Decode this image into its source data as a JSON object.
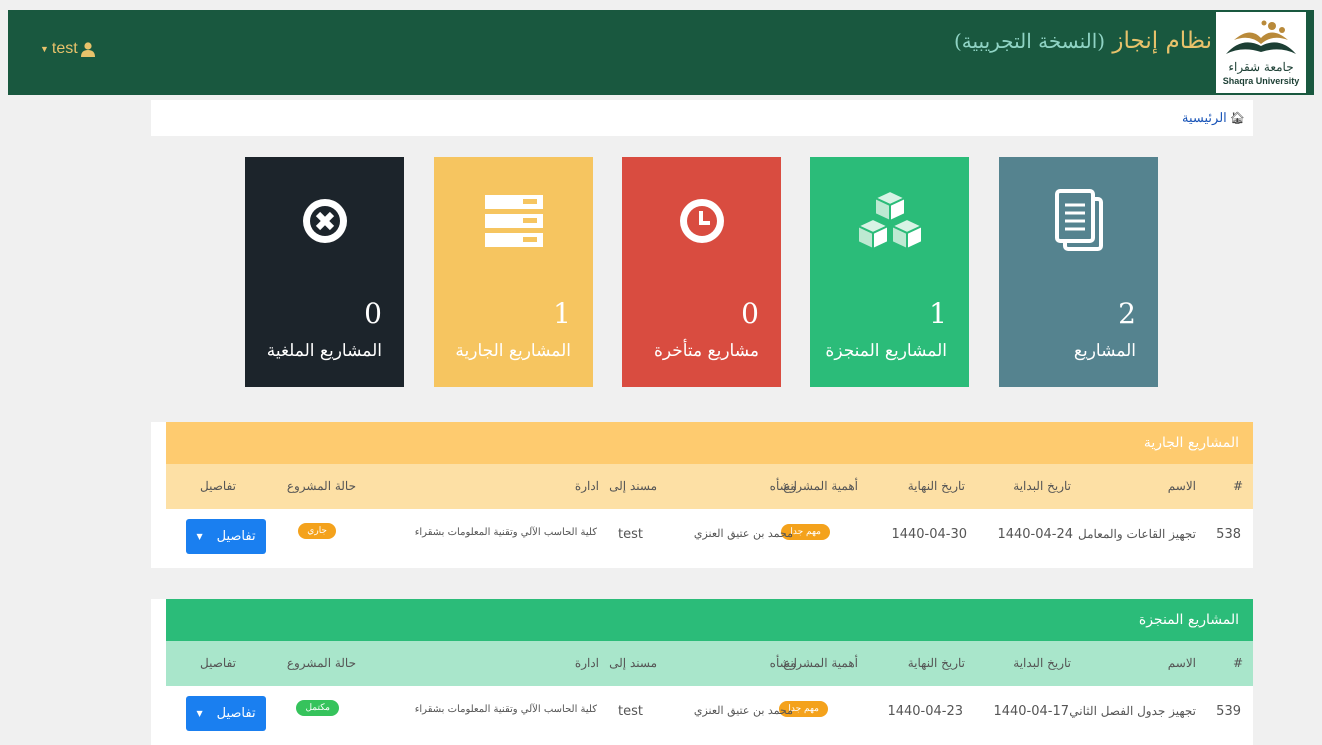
{
  "header": {
    "title": "نظام إنجاز",
    "subtitle": "(النسخة التجريبية)",
    "user": "test",
    "logo_text_ar": "جامعة شقراء",
    "logo_text_en": "Shaqra University"
  },
  "breadcrumb": {
    "home": "الرئيسية"
  },
  "stats": {
    "all": {
      "count": "2",
      "label": "المشاريع",
      "color": "#55838f"
    },
    "done": {
      "count": "1",
      "label": "المشاريع المنجزة",
      "color": "#2bbc79"
    },
    "late": {
      "count": "0",
      "label": "مشاريع متأخرة",
      "color": "#d94c40"
    },
    "running": {
      "count": "1",
      "label": "المشاريع الجارية",
      "color": "#f6c560"
    },
    "cancelled": {
      "count": "0",
      "label": "المشاريع الملغية",
      "color": "#1c242b"
    }
  },
  "columns": {
    "id": "#",
    "name": "الاسم",
    "start": "تاريخ البداية",
    "end": "تاريخ النهاية",
    "priority": "أهمية المشروع",
    "creator": "انشأه",
    "assigned": "مسند إلى",
    "dept": "ادارة",
    "status": "حالة المشروع",
    "details": "تفاصيل"
  },
  "running": {
    "title": "المشاريع الجارية",
    "row": {
      "id": "538",
      "name": "تجهيز القاعات والمعامل",
      "start": "1440-04-24",
      "end": "1440-04-30",
      "priority": "مهم جدا",
      "creator": "محمد بن عتيق العنزي",
      "assigned": "test",
      "dept": "كلية الحاسب الآلي وتقنية المعلومات بشقراء",
      "status": "جاري",
      "details": "تفاصيل"
    }
  },
  "completed": {
    "title": "المشاريع المنجزة",
    "row": {
      "id": "539",
      "name": "تجهيز جدول الفصل الثاني",
      "start": "1440-04-17",
      "end": "1440-04-23",
      "priority": "مهم جدا",
      "creator": "محمد بن عتيق العنزي",
      "assigned": "test",
      "dept": "كلية الحاسب الآلي وتقنية المعلومات بشقراء",
      "status": "مكتمل",
      "details": "تفاصيل"
    }
  },
  "colors": {
    "header_bg": "#19583f",
    "header_text": "#e8c26b",
    "running_head": "#fecb6f",
    "running_cols": "#fde0a5",
    "completed_head": "#2bbc79",
    "completed_cols": "#a9e6cb",
    "badge_priority": "#f4a21c",
    "badge_status_running": "#f4a21c",
    "badge_status_done": "#36c35c",
    "button": "#1a7ff0"
  },
  "icons": [
    "user-icon",
    "home-icon",
    "document-icon",
    "cubes-icon",
    "clock-icon",
    "server-icon",
    "cancel-icon",
    "caret-down-icon"
  ]
}
